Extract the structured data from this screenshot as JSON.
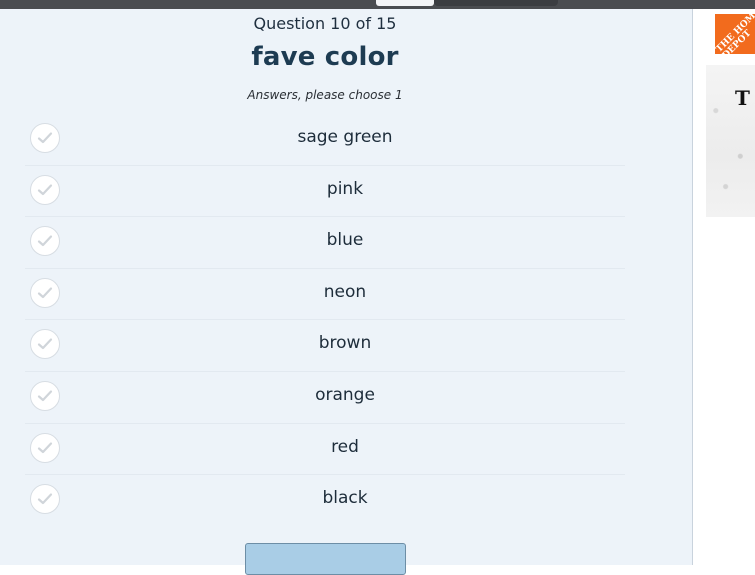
{
  "quiz": {
    "progress": "Question 10 of 15",
    "title": "fave color",
    "hint": "Answers, please choose 1",
    "answers": [
      {
        "label": "sage green"
      },
      {
        "label": "pink"
      },
      {
        "label": "blue"
      },
      {
        "label": "neon"
      },
      {
        "label": "brown"
      },
      {
        "label": "orange"
      },
      {
        "label": "red"
      },
      {
        "label": "black"
      }
    ]
  },
  "ad": {
    "logo_text": "THE HOME DEPOT",
    "letter": "T",
    "brand_color": "#f26b1d"
  },
  "colors": {
    "panel_bg": "#edf3f9",
    "title": "#1d3b52",
    "button": "#a9cde6"
  }
}
